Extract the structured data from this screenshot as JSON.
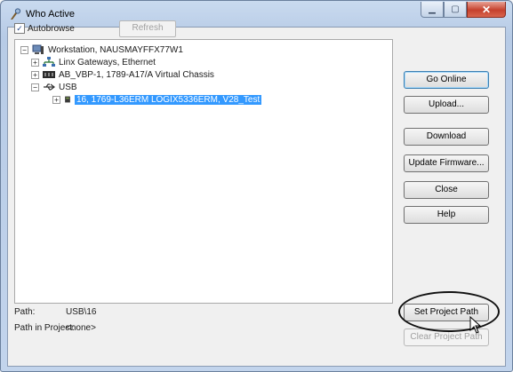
{
  "window": {
    "title": "Who Active"
  },
  "toolbar": {
    "autobrowse_label": "Autobrowse",
    "autobrowse_checked": true,
    "refresh_label": "Refresh"
  },
  "tree": {
    "workstation": "Workstation, NAUSMAYFFX77W1",
    "linx": "Linx Gateways, Ethernet",
    "ab_vbp": "AB_VBP-1, 1789-A17/A Virtual Chassis",
    "usb": "USB",
    "device": "16, 1769-L36ERM LOGIX5336ERM, V28_Test"
  },
  "buttons": {
    "go_online": "Go Online",
    "upload": "Upload...",
    "download": "Download",
    "update_firmware": "Update Firmware...",
    "close": "Close",
    "help": "Help",
    "set_project_path": "Set Project Path",
    "clear_project_path": "Clear Project Path"
  },
  "footer": {
    "path_label": "Path:",
    "path_value": "USB\\16",
    "project_path_label": "Path in Project:",
    "project_path_value": "<none>"
  },
  "icons": {
    "app": "who-active-icon",
    "workstation": "workstation-icon",
    "network": "network-icon",
    "chassis": "chassis-icon",
    "usb": "usb-icon",
    "device": "controller-icon",
    "cursor": "mouse-cursor-icon"
  },
  "colors": {
    "selection": "#3399ff",
    "close_button": "#c5412d"
  }
}
